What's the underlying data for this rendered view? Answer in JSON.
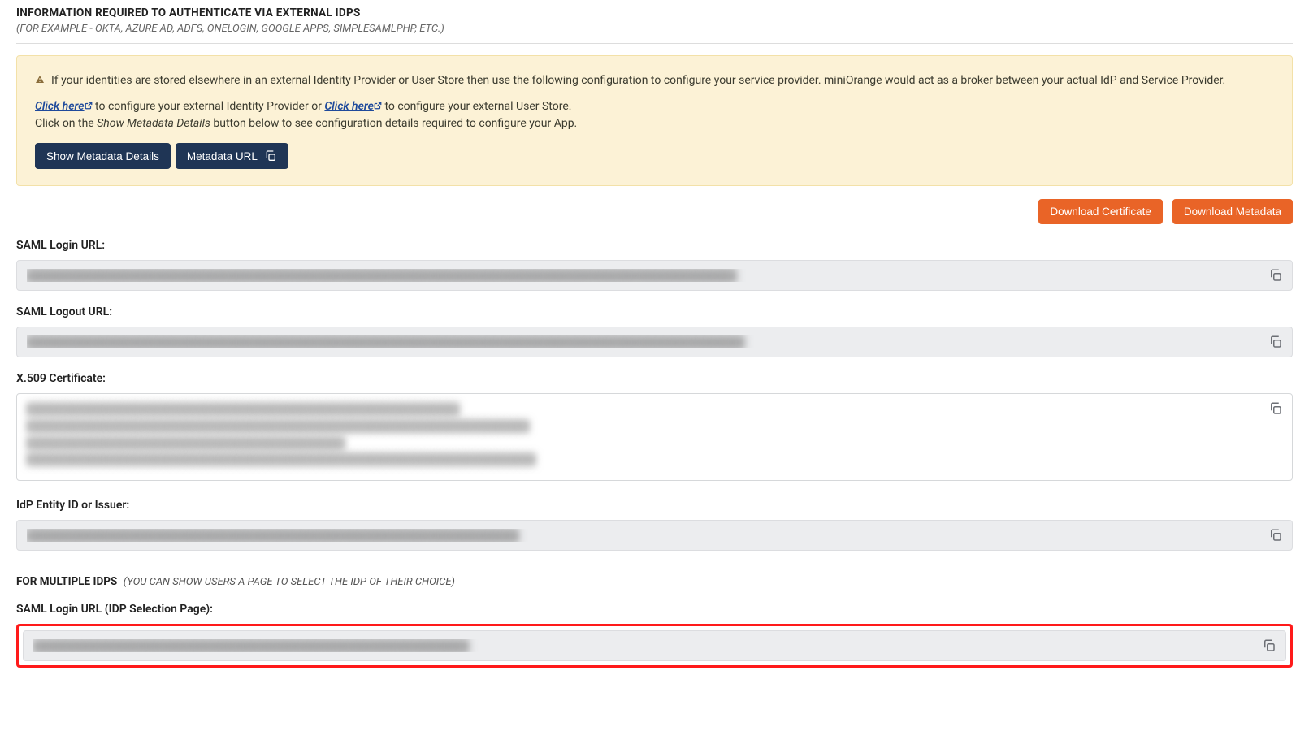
{
  "header": {
    "title": "INFORMATION REQUIRED TO AUTHENTICATE VIA EXTERNAL IDPS",
    "subtitle": "(FOR EXAMPLE - OKTA, AZURE AD, ADFS, ONELOGIN, GOOGLE APPS, SIMPLESAMLPHP, ETC.)"
  },
  "alert": {
    "intro": "If your identities are stored elsewhere in an external Identity Provider or User Store then use the following configuration to configure your service provider. miniOrange would act as a broker between your actual IdP and Service Provider.",
    "link1_text": "Click here",
    "mid1": " to configure your external Identity Provider or ",
    "link2_text": "Click here",
    "mid2": " to configure your external User Store.",
    "line2_pre": "Click on the ",
    "line2_em": "Show Metadata Details",
    "line2_post": " button below to see configuration details required to configure your App.",
    "btn_show_metadata": "Show Metadata Details",
    "btn_metadata_url": "Metadata URL"
  },
  "actions": {
    "download_cert": "Download Certificate",
    "download_meta": "Download Metadata"
  },
  "fields": {
    "saml_login": {
      "label": "SAML Login URL:",
      "value": "████████████████████████████████████████████████████████████████████████████████████████"
    },
    "saml_logout": {
      "label": "SAML Logout URL:",
      "value": "█████████████████████████████████████████████████████████████████████████████████████████"
    },
    "x509": {
      "label": "X.509 Certificate:",
      "value": "████████████████████████████████████████████████████████████████████\n███████████████████████████████████████████████████████████████████████████████\n██████████████████████████████████████████████████\n████████████████████████████████████████████████████████████████████████████████"
    },
    "idp_entity": {
      "label": "IdP Entity ID or Issuer:",
      "value": "█████████████████████████████████████████████████████████████"
    }
  },
  "multi": {
    "title": "FOR MULTIPLE IDPS",
    "subtitle": "(YOU CAN SHOW USERS A PAGE TO SELECT THE IDP OF THEIR CHOICE)",
    "saml_login_sel": {
      "label": "SAML Login URL (IDP Selection Page):",
      "value": "██████████████████████████████████████████████████████"
    }
  }
}
